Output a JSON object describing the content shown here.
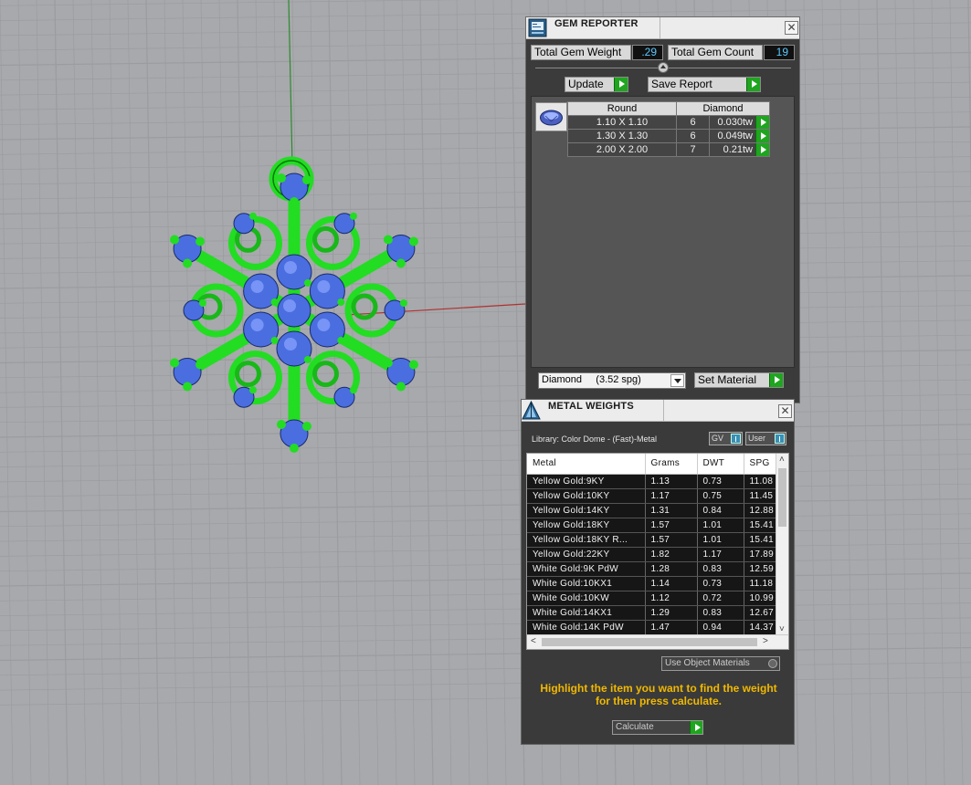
{
  "gem_reporter": {
    "title": "GEM REPORTER",
    "total_weight_label": "Total Gem Weight",
    "total_weight_value": ".29",
    "total_count_label": "Total Gem Count",
    "total_count_value": "19",
    "update_label": "Update",
    "save_report_label": "Save Report",
    "table": {
      "shape_header": "Round",
      "material_header": "Diamond",
      "rows": [
        {
          "size": "1.10 X 1.10",
          "count": "6",
          "weight": "0.030tw"
        },
        {
          "size": "1.30 X 1.30",
          "count": "6",
          "weight": "0.049tw"
        },
        {
          "size": "2.00 X 2.00",
          "count": "7",
          "weight": "0.21tw"
        }
      ]
    },
    "material_select_value": "Diamond     (3.52 spg)",
    "set_material_label": "Set Material"
  },
  "metal_weights": {
    "title": "METAL WEIGHTS",
    "library_label": "Library: Color Dome - (Fast)-Metal",
    "gv_toggle_label": "GV",
    "user_toggle_label": "User",
    "columns": [
      "Metal",
      "Grams",
      "DWT",
      "SPG"
    ],
    "rows": [
      [
        "Yellow Gold:9KY",
        "1.13",
        "0.73",
        "11.08"
      ],
      [
        "Yellow Gold:10KY",
        "1.17",
        "0.75",
        "11.45"
      ],
      [
        "Yellow Gold:14KY",
        "1.31",
        "0.84",
        "12.88"
      ],
      [
        "Yellow Gold:18KY",
        "1.57",
        "1.01",
        "15.41"
      ],
      [
        "Yellow Gold:18KY R...",
        "1.57",
        "1.01",
        "15.41"
      ],
      [
        "Yellow Gold:22KY",
        "1.82",
        "1.17",
        "17.89"
      ],
      [
        "White Gold:9K PdW",
        "1.28",
        "0.83",
        "12.59"
      ],
      [
        "White Gold:10KX1",
        "1.14",
        "0.73",
        "11.18"
      ],
      [
        "White Gold:10KW",
        "1.12",
        "0.72",
        "10.99"
      ],
      [
        "White Gold:14KX1",
        "1.29",
        "0.83",
        "12.67"
      ],
      [
        "White Gold:14K PdW",
        "1.47",
        "0.94",
        "14.37"
      ]
    ],
    "use_object_materials_label": "Use Object Materials",
    "hint_line1": "Highlight the item you want to find the weight",
    "hint_line2": "for then press calculate.",
    "calculate_label": "Calculate"
  },
  "colors": {
    "viewport_bg": "#a7a9ac",
    "grid_line": "#9a9c9f",
    "metal_green": "#22dd22",
    "gem_blue": "#4a6ee0",
    "hint_yellow": "#f0b800",
    "play_green": "#1fa51f"
  },
  "icons": {
    "gem_reporter_icon": "report-icon",
    "metal_weights_icon": "scale-icon",
    "gem_thumbnail": "round-diamond-icon"
  }
}
